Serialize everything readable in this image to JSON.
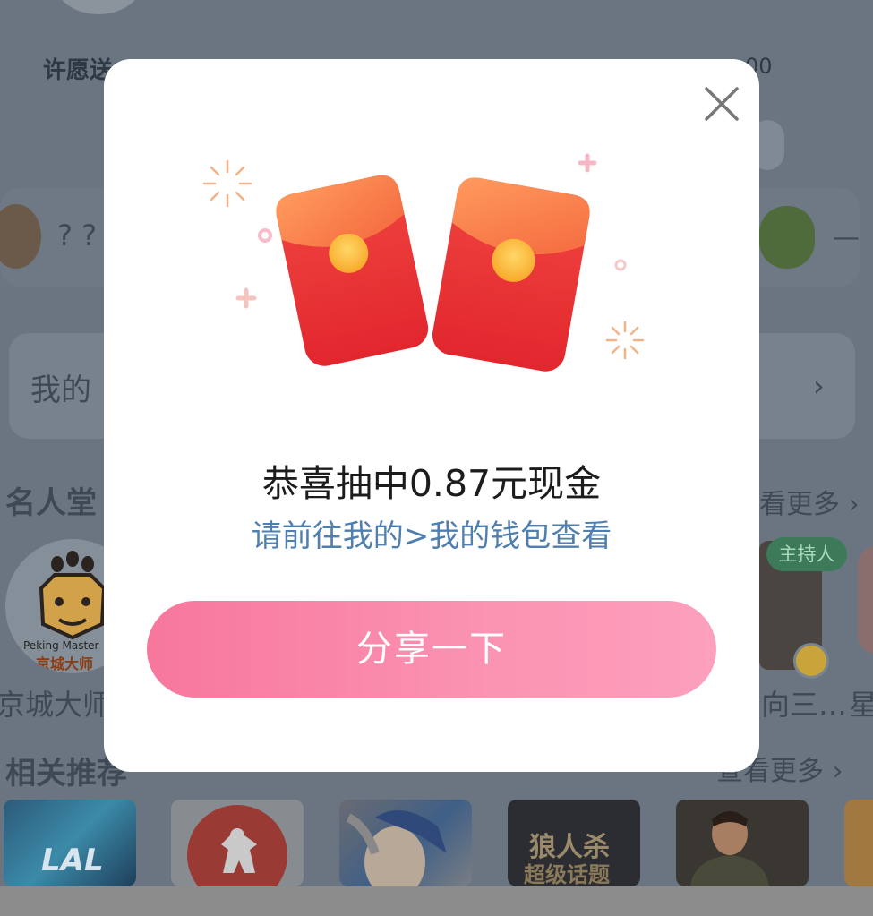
{
  "modal": {
    "title": "恭喜抽中0.87元现金",
    "subtitle": "请前往我的>我的钱包查看",
    "share_button": "分享一下"
  },
  "background": {
    "header_label": "许愿送",
    "header_number": "00",
    "question_marks": "? ?",
    "dash": "—",
    "my_section_label": "我的",
    "hall_of_fame": "名人堂",
    "see_more_1": "看更多 ›",
    "celebrity_name_1": "京城大师",
    "celebrity_name_2": "向三…",
    "celebrity_name_3": "星",
    "logo_text_en": "Peking Master",
    "logo_text_cn": "京城大师",
    "host_badge": "主持人",
    "related_recommend": "相关推荐",
    "see_more_2": "查看更多 ›",
    "thumb_lal": "LAL",
    "thumb_werewolf_1": "狼人杀",
    "thumb_werewolf_2": "超级话题"
  },
  "colors": {
    "accent_pink": "#f7779c",
    "subtitle_blue": "#4f7fae",
    "red_envelope": "#e8343a",
    "envelope_flap": "#f97a4a",
    "button_text": "#ffffff"
  },
  "icons": [
    "close-icon",
    "red-envelope-icon",
    "sparkle-icon",
    "plus-icon",
    "chevron-right-icon"
  ]
}
